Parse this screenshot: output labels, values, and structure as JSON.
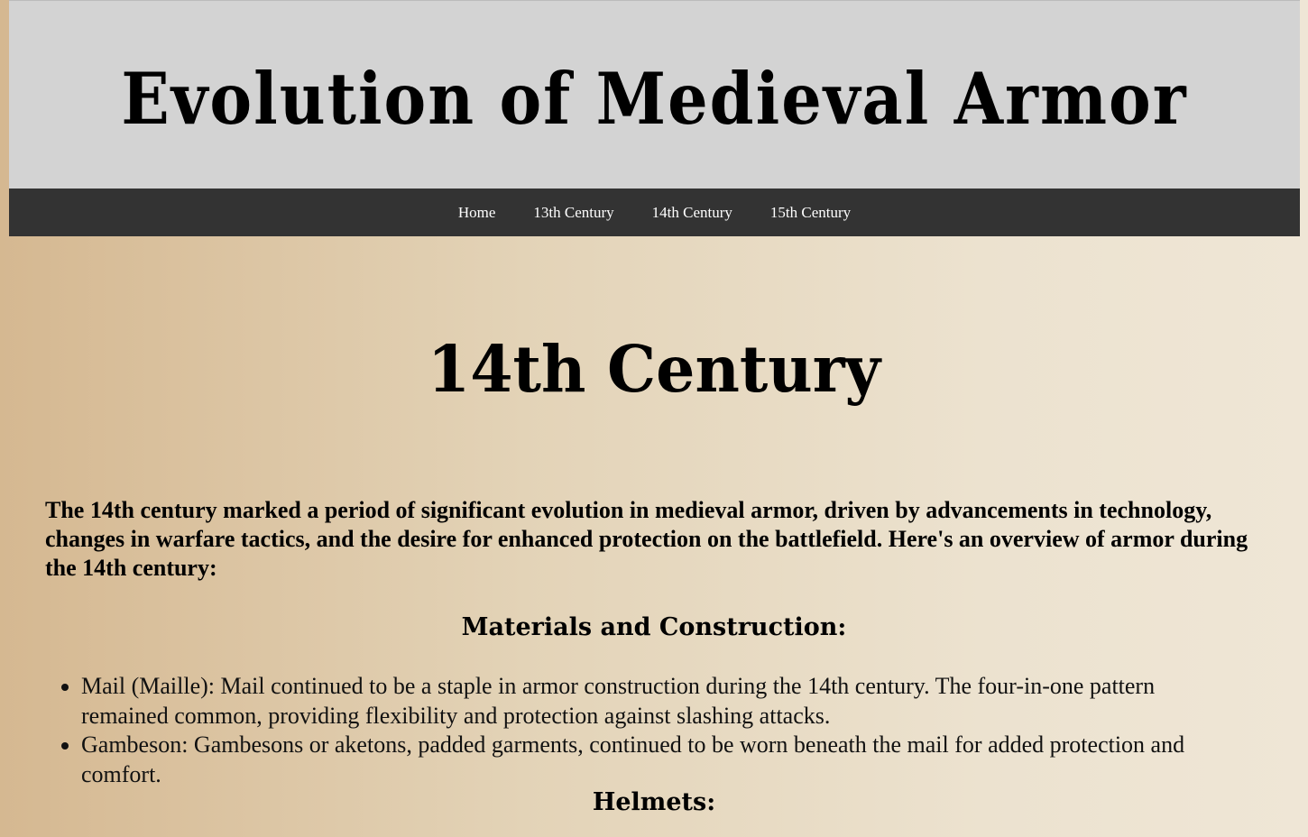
{
  "header": {
    "title": "Evolution of Medieval Armor"
  },
  "nav": {
    "links": [
      "Home",
      "13th Century",
      "14th Century",
      "15th Century"
    ]
  },
  "main": {
    "heading": "14th Century",
    "intro": "The 14th century marked a period of significant evolution in medieval armor, driven by advancements in technology, changes in warfare tactics, and the desire for enhanced protection on the battlefield. Here's an overview of armor during the 14th century:",
    "sections": [
      {
        "heading": "Materials and Construction:",
        "items": [
          "Mail (Maille): Mail continued to be a staple in armor construction during the 14th century. The four-in-one pattern remained common, providing flexibility and protection against slashing attacks.",
          "Gambeson: Gambesons or aketons, padded garments, continued to be worn beneath the mail for added protection and comfort."
        ]
      },
      {
        "heading": "Helmets:"
      }
    ]
  },
  "colors": {
    "header_bg": "#d3d3d3",
    "nav_bg": "#333333",
    "nav_text": "#ffffff",
    "page_bg_left": "#d5b891",
    "page_bg_right": "#efe6d6"
  }
}
